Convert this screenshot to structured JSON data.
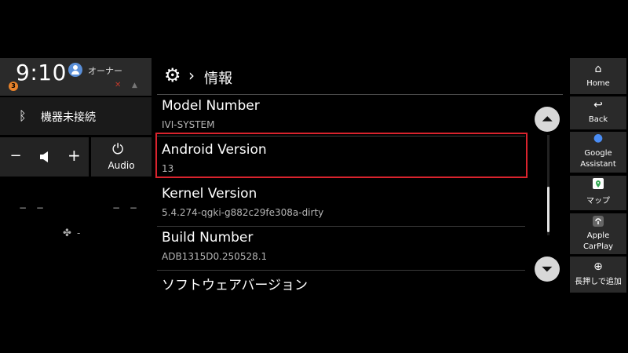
{
  "status": {
    "time": "9:10",
    "user_label": "オーナー",
    "notification_count": "3"
  },
  "left_panel": {
    "bluetooth_label": "機器未接続",
    "volume_minus": "−",
    "volume_plus": "+",
    "audio_label": "Audio",
    "temp_left": "− −",
    "temp_right": "− −",
    "fan_value": "-"
  },
  "header": {
    "title": "情報"
  },
  "info_list": [
    {
      "title": "Model Number",
      "value": "IVI-SYSTEM"
    },
    {
      "title": "Android Version",
      "value": "13"
    },
    {
      "title": "Kernel Version",
      "value": "5.4.274-qgki-g882c29fe308a-dirty"
    },
    {
      "title": "Build Number",
      "value": "ADB1315D0.250528.1"
    },
    {
      "title": "ソフトウェアバージョン",
      "value": ""
    }
  ],
  "dock": {
    "home": "Home",
    "back": "Back",
    "assistant_line1": "Google",
    "assistant_line2": "Assistant",
    "maps": "マップ",
    "carplay_line1": "Apple",
    "carplay_line2": "CarPlay",
    "add": "長押しで追加"
  },
  "colors": {
    "highlight_border": "#d9232d",
    "notification_badge": "#e8822a",
    "panel_bg": "#2a2a2a"
  },
  "icons": [
    "gear-icon",
    "chevron-right-icon",
    "bluetooth-icon",
    "speaker-icon",
    "power-icon",
    "fan-icon",
    "home-icon",
    "back-icon",
    "mic-icon",
    "maps-icon",
    "carplay-icon",
    "plus-icon",
    "scroll-up-icon",
    "scroll-down-icon"
  ]
}
